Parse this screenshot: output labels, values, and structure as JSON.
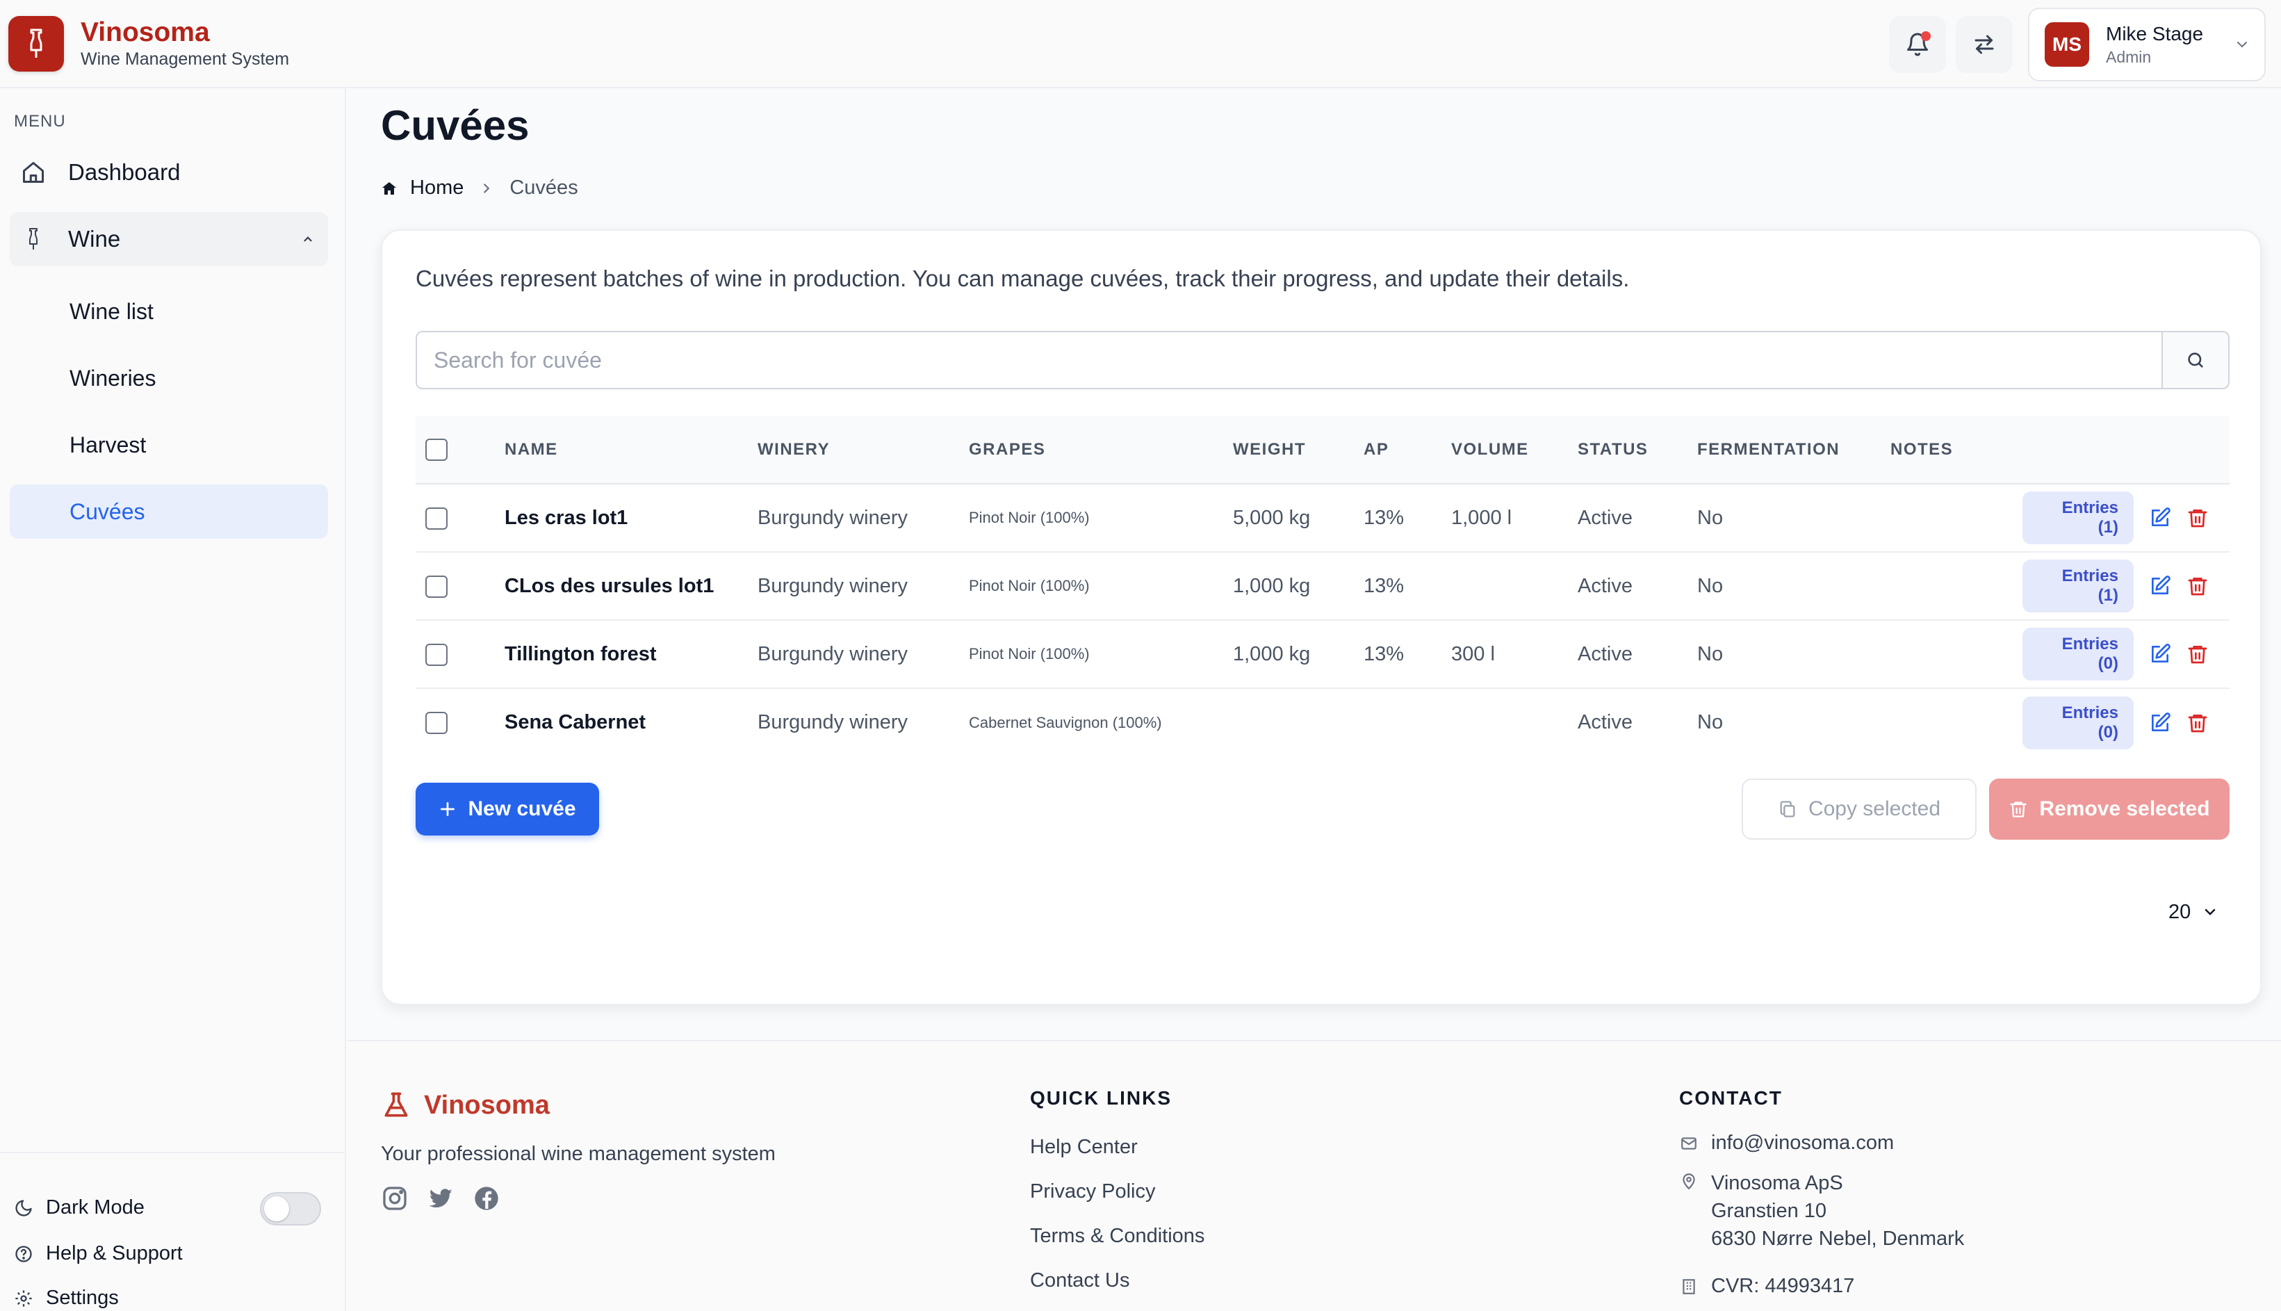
{
  "header": {
    "brand_name": "Vinosoma",
    "brand_subtitle": "Wine Management System",
    "user_initials": "MS",
    "user_name": "Mike Stage",
    "user_role": "Admin"
  },
  "sidebar": {
    "menu_label": "MENU",
    "items": [
      {
        "label": "Dashboard",
        "icon": "home-icon"
      },
      {
        "label": "Wine",
        "icon": "wine-bottle-icon",
        "expanded": true
      },
      {
        "label": "Wine list"
      },
      {
        "label": "Wineries"
      },
      {
        "label": "Harvest"
      },
      {
        "label": "Cuvées",
        "active": true
      }
    ],
    "bottom": {
      "dark_mode": "Dark Mode",
      "dark_mode_on": false,
      "help": "Help & Support",
      "settings": "Settings"
    }
  },
  "page": {
    "title": "Cuvées",
    "breadcrumb": {
      "home": "Home",
      "current": "Cuvées"
    },
    "description": "Cuvées represent batches of wine in production. You can manage cuvées, track their progress, and update their details.",
    "search_placeholder": "Search for cuvée"
  },
  "table": {
    "columns": [
      "NAME",
      "WINERY",
      "GRAPES",
      "WEIGHT",
      "AP",
      "VOLUME",
      "STATUS",
      "FERMENTATION",
      "NOTES"
    ],
    "rows": [
      {
        "name": "Les cras lot1",
        "winery": "Burgundy winery",
        "grapes": "Pinot Noir (100%)",
        "weight": "5,000 kg",
        "ap": "13%",
        "volume": "1,000 l",
        "status": "Active",
        "fermentation": "No",
        "notes": "",
        "entries": "Entries (1)"
      },
      {
        "name": "CLos des ursules lot1",
        "winery": "Burgundy winery",
        "grapes": "Pinot Noir (100%)",
        "weight": "1,000 kg",
        "ap": "13%",
        "volume": "",
        "status": "Active",
        "fermentation": "No",
        "notes": "",
        "entries": "Entries (1)"
      },
      {
        "name": "Tillington forest",
        "winery": "Burgundy winery",
        "grapes": "Pinot Noir (100%)",
        "weight": "1,000 kg",
        "ap": "13%",
        "volume": "300 l",
        "status": "Active",
        "fermentation": "No",
        "notes": "",
        "entries": "Entries (0)"
      },
      {
        "name": "Sena Cabernet",
        "winery": "Burgundy winery",
        "grapes": "Cabernet Sauvignon (100%)",
        "weight": "",
        "ap": "",
        "volume": "",
        "status": "Active",
        "fermentation": "No",
        "notes": "",
        "entries": "Entries (0)"
      }
    ]
  },
  "buttons": {
    "new": "New cuvée",
    "copy": "Copy selected",
    "remove": "Remove selected"
  },
  "pagination": {
    "page_size": "20"
  },
  "footer": {
    "brand": "Vinosoma",
    "tagline": "Your professional wine management system",
    "quick_links_title": "QUICK LINKS",
    "quick_links": [
      "Help Center",
      "Privacy Policy",
      "Terms & Conditions",
      "Contact Us"
    ],
    "contact_title": "CONTACT",
    "email": "info@vinosoma.com",
    "address": [
      "Vinosoma ApS",
      "Granstien 10",
      "6830 Nørre Nebel, Denmark"
    ],
    "cvr": "CVR: 44993417"
  },
  "colors": {
    "brand": "#b42318",
    "primary": "#2563eb",
    "danger": "#dc2626",
    "active_nav_bg": "#e8eefb"
  }
}
